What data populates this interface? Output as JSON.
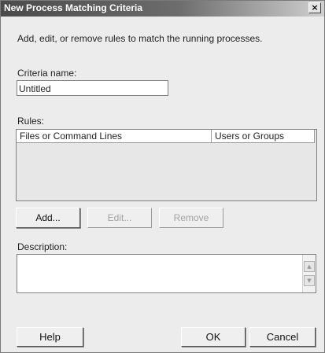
{
  "window": {
    "title": "New Process Matching Criteria",
    "close_glyph": "×"
  },
  "intro_text": "Add, edit, or remove rules to match the running processes.",
  "criteria_name": {
    "label": "Criteria name:",
    "value": "Untitled"
  },
  "rules": {
    "label": "Rules:",
    "columns": [
      "Files or Command Lines",
      "Users or Groups"
    ],
    "rows": []
  },
  "rule_buttons": {
    "add": "Add...",
    "edit": "Edit...",
    "remove": "Remove"
  },
  "description": {
    "label": "Description:",
    "value": "",
    "scroll_up_glyph": "▲",
    "scroll_down_glyph": "▼"
  },
  "dialog_buttons": {
    "help": "Help",
    "ok": "OK",
    "cancel": "Cancel"
  },
  "colors": {
    "title_gradient_start": "#4a4a4a",
    "window_background": "#ececec",
    "disabled_text": "#a3a3a3"
  }
}
